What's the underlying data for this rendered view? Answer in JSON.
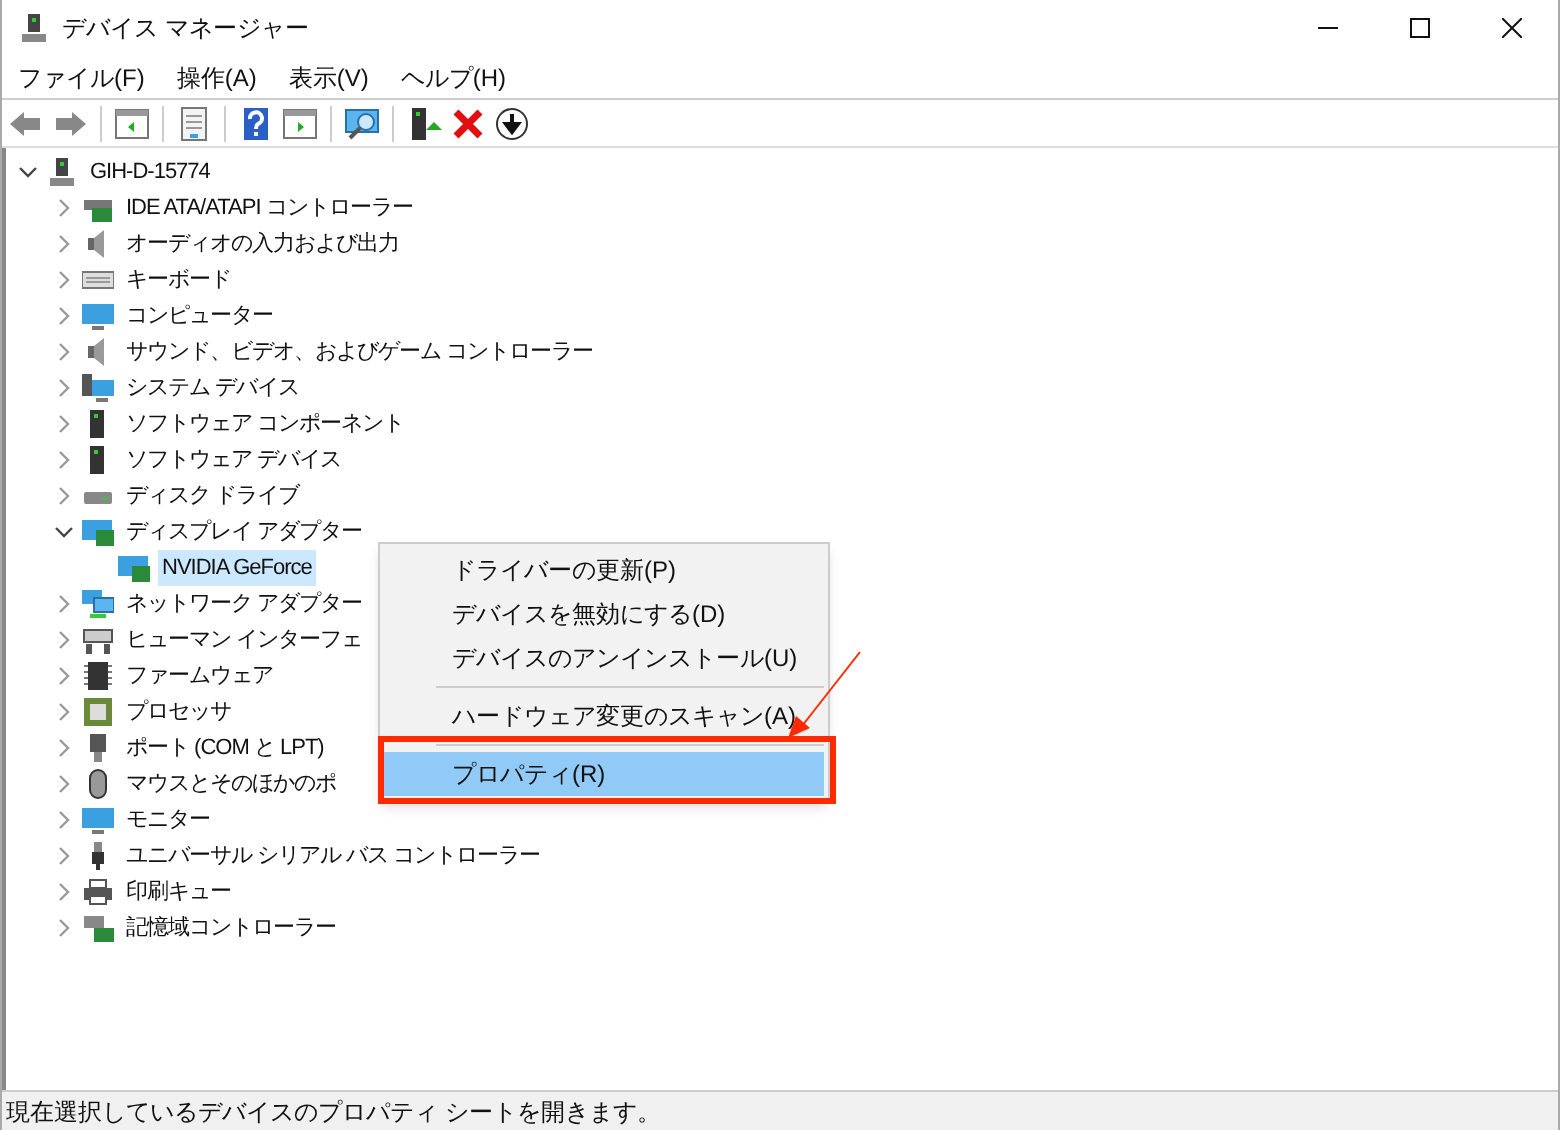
{
  "window": {
    "title": "デバイス マネージャー"
  },
  "menu": [
    "ファイル(F)",
    "操作(A)",
    "表示(V)",
    "ヘルプ(H)"
  ],
  "toolbar": [
    {
      "kind": "back"
    },
    {
      "kind": "forward"
    },
    {
      "kind": "sep"
    },
    {
      "kind": "tree"
    },
    {
      "kind": "sep"
    },
    {
      "kind": "props"
    },
    {
      "kind": "sep"
    },
    {
      "kind": "help"
    },
    {
      "kind": "view"
    },
    {
      "kind": "sep"
    },
    {
      "kind": "scan"
    },
    {
      "kind": "sep"
    },
    {
      "kind": "update"
    },
    {
      "kind": "remove"
    },
    {
      "kind": "disable"
    }
  ],
  "tree": {
    "label": "GIH-D-15774",
    "expanded": true,
    "children": [
      {
        "label": "IDE ATA/ATAPI コントローラー",
        "expanded": false
      },
      {
        "label": "オーディオの入力および出力",
        "expanded": false
      },
      {
        "label": "キーボード",
        "expanded": false
      },
      {
        "label": "コンピューター",
        "expanded": false
      },
      {
        "label": "サウンド、ビデオ、およびゲーム コントローラー",
        "expanded": false
      },
      {
        "label": "システム デバイス",
        "expanded": false
      },
      {
        "label": "ソフトウェア コンポーネント",
        "expanded": false
      },
      {
        "label": "ソフトウェア デバイス",
        "expanded": false
      },
      {
        "label": "ディスク ドライブ",
        "expanded": false
      },
      {
        "label": "ディスプレイ アダプター",
        "expanded": true,
        "children": [
          {
            "label": "NVIDIA GeForce",
            "selected": true
          }
        ]
      },
      {
        "label": "ネットワーク アダプター",
        "expanded": false
      },
      {
        "label": "ヒューマン インターフェ",
        "expanded": false
      },
      {
        "label": "ファームウェア",
        "expanded": false
      },
      {
        "label": "プロセッサ",
        "expanded": false
      },
      {
        "label": "ポート (COM と LPT)",
        "expanded": false
      },
      {
        "label": "マウスとそのほかのポ",
        "expanded": false
      },
      {
        "label": "モニター",
        "expanded": false
      },
      {
        "label": "ユニバーサル シリアル バス コントローラー",
        "expanded": false
      },
      {
        "label": "印刷キュー",
        "expanded": false
      },
      {
        "label": "記憶域コントローラー",
        "expanded": false
      }
    ]
  },
  "context_menu": [
    {
      "label": "ドライバーの更新(P)",
      "selected": false
    },
    {
      "label": "デバイスを無効にする(D)",
      "selected": false
    },
    {
      "label": "デバイスのアンインストール(U)",
      "selected": false
    },
    {
      "kind": "sep"
    },
    {
      "label": "ハードウェア変更のスキャン(A)",
      "selected": false
    },
    {
      "kind": "sep"
    },
    {
      "label": "プロパティ(R)",
      "selected": true,
      "highlighted": true
    }
  ],
  "status_bar": "現在選択しているデバイスのプロパティ シートを開きます。"
}
